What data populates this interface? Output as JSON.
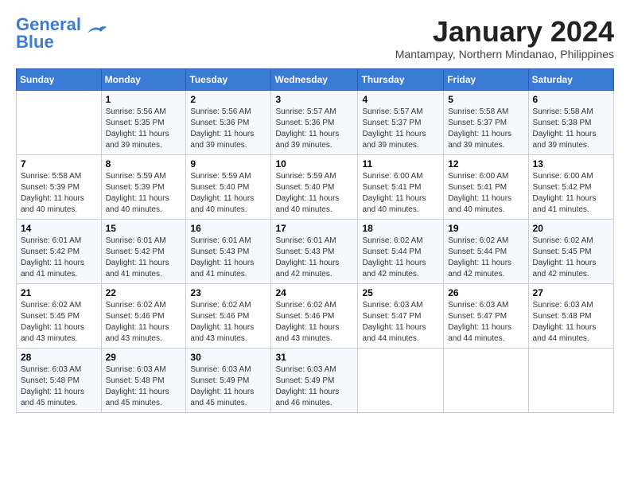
{
  "logo": {
    "line1": "General",
    "line2": "Blue"
  },
  "title": "January 2024",
  "location": "Mantampay, Northern Mindanao, Philippines",
  "days_of_week": [
    "Sunday",
    "Monday",
    "Tuesday",
    "Wednesday",
    "Thursday",
    "Friday",
    "Saturday"
  ],
  "weeks": [
    [
      {
        "day": "",
        "sunrise": "",
        "sunset": "",
        "daylight": ""
      },
      {
        "day": "1",
        "sunrise": "Sunrise: 5:56 AM",
        "sunset": "Sunset: 5:35 PM",
        "daylight": "Daylight: 11 hours and 39 minutes."
      },
      {
        "day": "2",
        "sunrise": "Sunrise: 5:56 AM",
        "sunset": "Sunset: 5:36 PM",
        "daylight": "Daylight: 11 hours and 39 minutes."
      },
      {
        "day": "3",
        "sunrise": "Sunrise: 5:57 AM",
        "sunset": "Sunset: 5:36 PM",
        "daylight": "Daylight: 11 hours and 39 minutes."
      },
      {
        "day": "4",
        "sunrise": "Sunrise: 5:57 AM",
        "sunset": "Sunset: 5:37 PM",
        "daylight": "Daylight: 11 hours and 39 minutes."
      },
      {
        "day": "5",
        "sunrise": "Sunrise: 5:58 AM",
        "sunset": "Sunset: 5:37 PM",
        "daylight": "Daylight: 11 hours and 39 minutes."
      },
      {
        "day": "6",
        "sunrise": "Sunrise: 5:58 AM",
        "sunset": "Sunset: 5:38 PM",
        "daylight": "Daylight: 11 hours and 39 minutes."
      }
    ],
    [
      {
        "day": "7",
        "sunrise": "Sunrise: 5:58 AM",
        "sunset": "Sunset: 5:39 PM",
        "daylight": "Daylight: 11 hours and 40 minutes."
      },
      {
        "day": "8",
        "sunrise": "Sunrise: 5:59 AM",
        "sunset": "Sunset: 5:39 PM",
        "daylight": "Daylight: 11 hours and 40 minutes."
      },
      {
        "day": "9",
        "sunrise": "Sunrise: 5:59 AM",
        "sunset": "Sunset: 5:40 PM",
        "daylight": "Daylight: 11 hours and 40 minutes."
      },
      {
        "day": "10",
        "sunrise": "Sunrise: 5:59 AM",
        "sunset": "Sunset: 5:40 PM",
        "daylight": "Daylight: 11 hours and 40 minutes."
      },
      {
        "day": "11",
        "sunrise": "Sunrise: 6:00 AM",
        "sunset": "Sunset: 5:41 PM",
        "daylight": "Daylight: 11 hours and 40 minutes."
      },
      {
        "day": "12",
        "sunrise": "Sunrise: 6:00 AM",
        "sunset": "Sunset: 5:41 PM",
        "daylight": "Daylight: 11 hours and 40 minutes."
      },
      {
        "day": "13",
        "sunrise": "Sunrise: 6:00 AM",
        "sunset": "Sunset: 5:42 PM",
        "daylight": "Daylight: 11 hours and 41 minutes."
      }
    ],
    [
      {
        "day": "14",
        "sunrise": "Sunrise: 6:01 AM",
        "sunset": "Sunset: 5:42 PM",
        "daylight": "Daylight: 11 hours and 41 minutes."
      },
      {
        "day": "15",
        "sunrise": "Sunrise: 6:01 AM",
        "sunset": "Sunset: 5:42 PM",
        "daylight": "Daylight: 11 hours and 41 minutes."
      },
      {
        "day": "16",
        "sunrise": "Sunrise: 6:01 AM",
        "sunset": "Sunset: 5:43 PM",
        "daylight": "Daylight: 11 hours and 41 minutes."
      },
      {
        "day": "17",
        "sunrise": "Sunrise: 6:01 AM",
        "sunset": "Sunset: 5:43 PM",
        "daylight": "Daylight: 11 hours and 42 minutes."
      },
      {
        "day": "18",
        "sunrise": "Sunrise: 6:02 AM",
        "sunset": "Sunset: 5:44 PM",
        "daylight": "Daylight: 11 hours and 42 minutes."
      },
      {
        "day": "19",
        "sunrise": "Sunrise: 6:02 AM",
        "sunset": "Sunset: 5:44 PM",
        "daylight": "Daylight: 11 hours and 42 minutes."
      },
      {
        "day": "20",
        "sunrise": "Sunrise: 6:02 AM",
        "sunset": "Sunset: 5:45 PM",
        "daylight": "Daylight: 11 hours and 42 minutes."
      }
    ],
    [
      {
        "day": "21",
        "sunrise": "Sunrise: 6:02 AM",
        "sunset": "Sunset: 5:45 PM",
        "daylight": "Daylight: 11 hours and 43 minutes."
      },
      {
        "day": "22",
        "sunrise": "Sunrise: 6:02 AM",
        "sunset": "Sunset: 5:46 PM",
        "daylight": "Daylight: 11 hours and 43 minutes."
      },
      {
        "day": "23",
        "sunrise": "Sunrise: 6:02 AM",
        "sunset": "Sunset: 5:46 PM",
        "daylight": "Daylight: 11 hours and 43 minutes."
      },
      {
        "day": "24",
        "sunrise": "Sunrise: 6:02 AM",
        "sunset": "Sunset: 5:46 PM",
        "daylight": "Daylight: 11 hours and 43 minutes."
      },
      {
        "day": "25",
        "sunrise": "Sunrise: 6:03 AM",
        "sunset": "Sunset: 5:47 PM",
        "daylight": "Daylight: 11 hours and 44 minutes."
      },
      {
        "day": "26",
        "sunrise": "Sunrise: 6:03 AM",
        "sunset": "Sunset: 5:47 PM",
        "daylight": "Daylight: 11 hours and 44 minutes."
      },
      {
        "day": "27",
        "sunrise": "Sunrise: 6:03 AM",
        "sunset": "Sunset: 5:48 PM",
        "daylight": "Daylight: 11 hours and 44 minutes."
      }
    ],
    [
      {
        "day": "28",
        "sunrise": "Sunrise: 6:03 AM",
        "sunset": "Sunset: 5:48 PM",
        "daylight": "Daylight: 11 hours and 45 minutes."
      },
      {
        "day": "29",
        "sunrise": "Sunrise: 6:03 AM",
        "sunset": "Sunset: 5:48 PM",
        "daylight": "Daylight: 11 hours and 45 minutes."
      },
      {
        "day": "30",
        "sunrise": "Sunrise: 6:03 AM",
        "sunset": "Sunset: 5:49 PM",
        "daylight": "Daylight: 11 hours and 45 minutes."
      },
      {
        "day": "31",
        "sunrise": "Sunrise: 6:03 AM",
        "sunset": "Sunset: 5:49 PM",
        "daylight": "Daylight: 11 hours and 46 minutes."
      },
      {
        "day": "",
        "sunrise": "",
        "sunset": "",
        "daylight": ""
      },
      {
        "day": "",
        "sunrise": "",
        "sunset": "",
        "daylight": ""
      },
      {
        "day": "",
        "sunrise": "",
        "sunset": "",
        "daylight": ""
      }
    ]
  ]
}
